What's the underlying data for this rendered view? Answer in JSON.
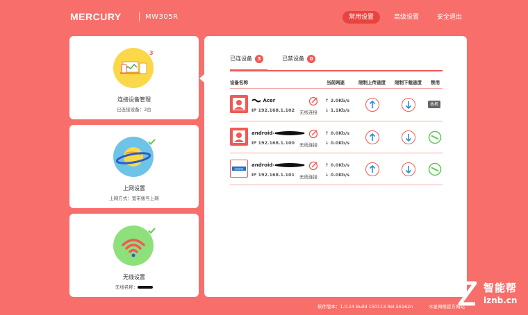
{
  "header": {
    "brand": "MERCURY",
    "model": "MW305R",
    "nav": [
      {
        "label": "常用设置",
        "active": true
      },
      {
        "label": "高级设置",
        "active": false
      },
      {
        "label": "安全退出",
        "active": false
      }
    ]
  },
  "cards": {
    "devices": {
      "title": "连接设备管理",
      "subtitle": "已连接设备：3台",
      "badge": "3"
    },
    "internet": {
      "title": "上网设置",
      "subtitle": "上网方式：宽带拨号上网"
    },
    "wireless": {
      "title": "无线设置",
      "subtitle": "无线名称："
    }
  },
  "panel": {
    "tabs": [
      {
        "label": "已连设备",
        "count": "3"
      },
      {
        "label": "已禁设备",
        "count": "0"
      }
    ],
    "columns": {
      "name": "设备名称",
      "speed": "当前网速",
      "upload_limit": "限制上传速度",
      "download_limit": "限制下载速度",
      "ban": "禁用"
    },
    "devices": [
      {
        "name": "Acer",
        "ip": "IP 192.168.1.102",
        "conn": "无线连接",
        "up": "2.0Kb/s",
        "down": "1.1Kb/s",
        "tag": "本机"
      },
      {
        "name": "android-",
        "ip": "IP 192.168.1.100",
        "conn": "无线连接",
        "up": "0.0Kb/s",
        "down": "0.0Kb/s",
        "tag": ""
      },
      {
        "name": "android-",
        "ip": "IP 192.168.1.101",
        "conn": "无线连接",
        "up": "0.0Kb/s",
        "down": "0.0Kb/s",
        "tag": "",
        "brand": "Lenovo"
      }
    ]
  },
  "footer": {
    "version": "软件版本：1.0.24 Build 150113 Rel.56162n",
    "site": "水星网络官方网站"
  },
  "watermark": {
    "text": "智能帮",
    "url": "iznb.cn"
  },
  "colors": {
    "accent": "#f05a55",
    "background": "#f86e6a",
    "ok": "#5cc94f",
    "arrow": "#1f8fe0"
  }
}
